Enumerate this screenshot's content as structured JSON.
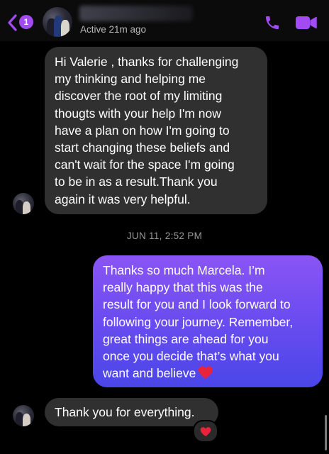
{
  "header": {
    "unread_count": "1",
    "status": "Active 21m ago",
    "back_icon": "chevron-left-icon",
    "call_icon": "phone-icon",
    "video_icon": "video-camera-icon",
    "accent_color": "#a24bf2"
  },
  "messages": [
    {
      "direction": "incoming",
      "text": "Hi Valerie , thanks for challenging\nmy thinking and helping me\ndiscover the root of my limiting\nthougts with your help I'm now\nhave a plan on how I'm going to\nstart changing these beliefs and\ncan't wait for the space I'm going\nto be in as a result.Thank you\nagain it was very helpful."
    },
    {
      "direction": "outgoing",
      "text": "Thanks so much Marcela. I’m\nreally happy that this was the\nresult for you and I look forward to\nfollowing your journey. Remember,\ngreat things are ahead for you\nonce you decide that’s what you\nwant and believe",
      "emoji": "heart-icon"
    },
    {
      "direction": "incoming",
      "text": "Thank you for everything.",
      "reaction": "heart-icon"
    }
  ],
  "timestamp": "JUN 11, 2:52 PM",
  "colors": {
    "incoming_bubble": "#303030",
    "outgoing_gradient_top": "#8a54f5",
    "outgoing_gradient_bottom": "#4a46e8",
    "heart": "#e8233a"
  }
}
